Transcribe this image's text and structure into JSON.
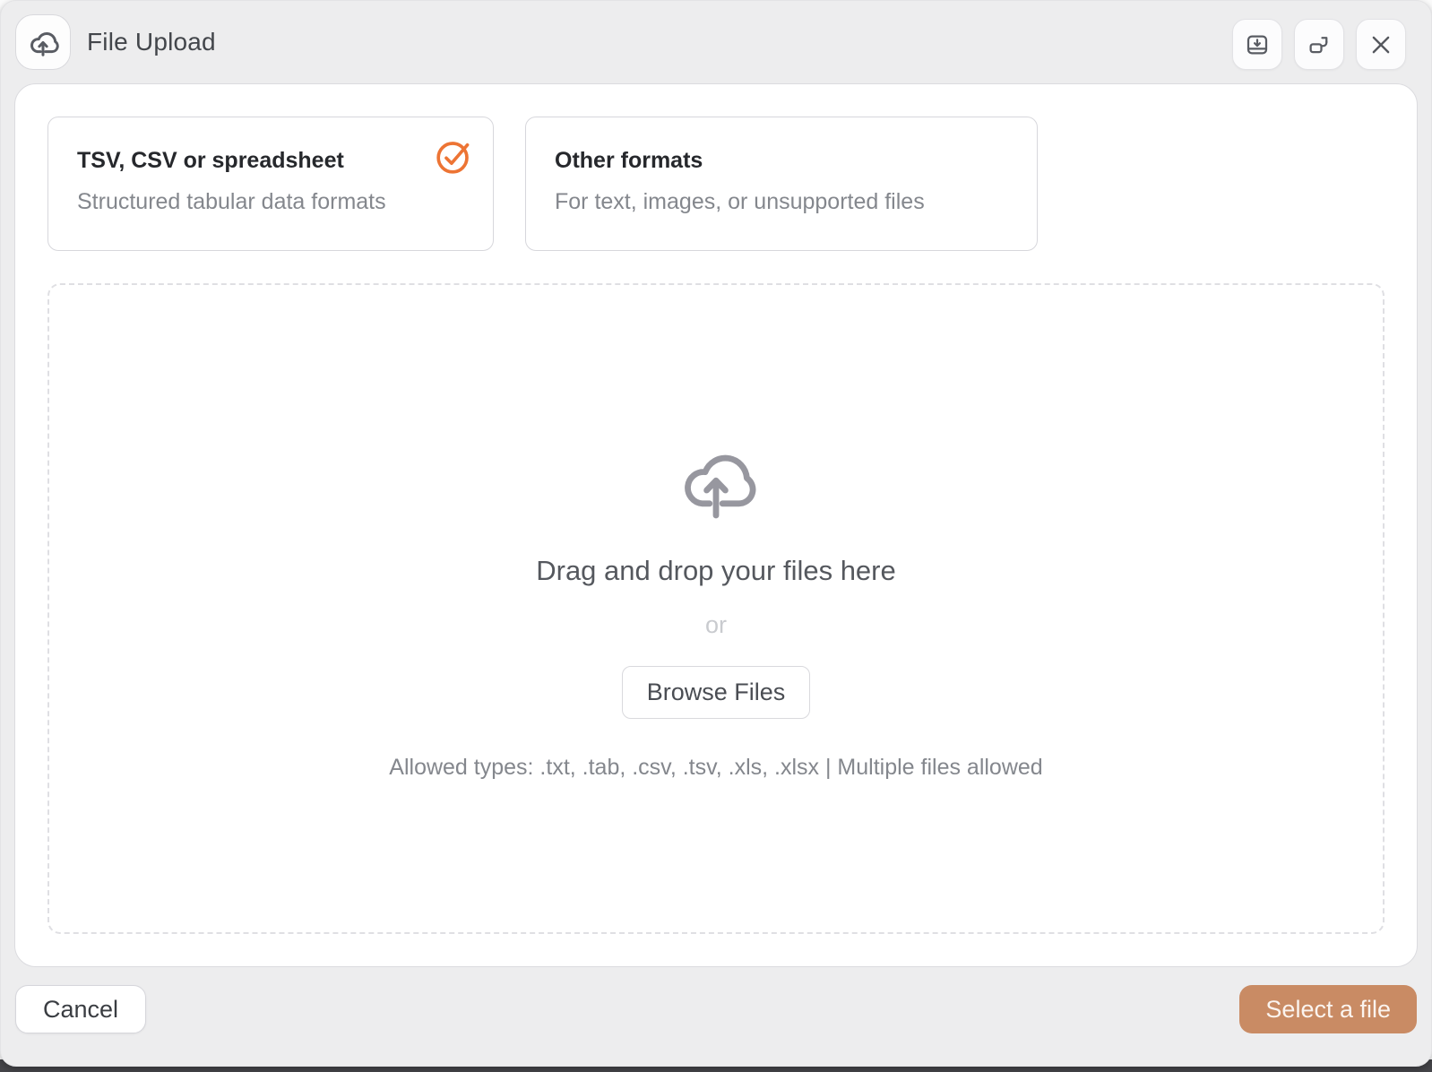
{
  "dialog": {
    "title": "File Upload"
  },
  "icons": {
    "badge": "cloud-upload-icon",
    "titlebar": [
      "download-icon",
      "popout-icon",
      "close-icon"
    ],
    "selected_marker": "check-circle-icon",
    "dropzone": "cloud-upload-icon"
  },
  "format_options": [
    {
      "title": "TSV, CSV or spreadsheet",
      "subtitle": "Structured tabular data formats",
      "selected": true
    },
    {
      "title": "Other formats",
      "subtitle": "For text, images, or unsupported files",
      "selected": false
    }
  ],
  "dropzone": {
    "heading": "Drag and drop your files here",
    "separator": "or",
    "browse_label": "Browse Files",
    "allowed_text": "Allowed types: .txt, .tab, .csv, .tsv, .xls, .xlsx | Multiple files allowed"
  },
  "footer": {
    "cancel_label": "Cancel",
    "select_label": "Select a file"
  },
  "colors": {
    "accent_orange": "#ED7434",
    "select_button_bg": "#C98B64",
    "chrome_gray": "#EDEDEE",
    "panel_white": "#FFFFFF",
    "icon_gray": "#5C5F66"
  }
}
